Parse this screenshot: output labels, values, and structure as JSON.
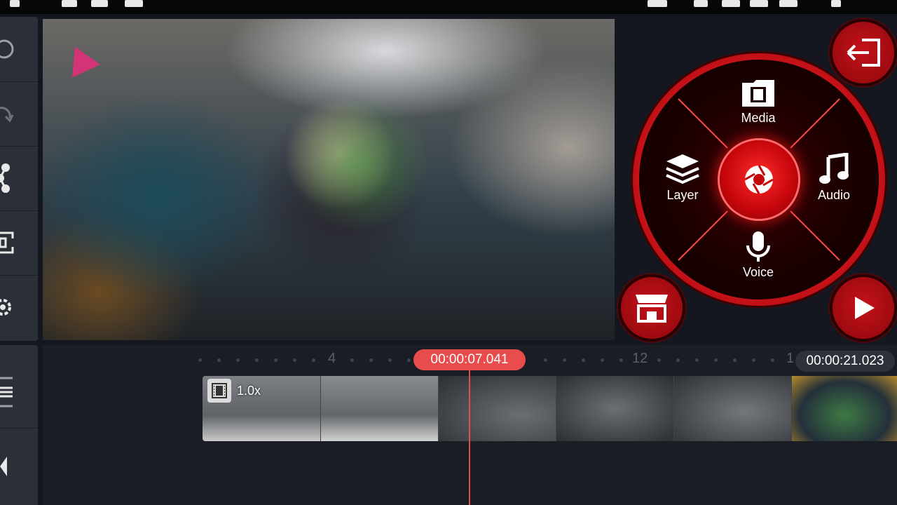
{
  "radial_menu": {
    "media_label": "Media",
    "audio_label": "Audio",
    "layer_label": "Layer",
    "voice_label": "Voice"
  },
  "timeline": {
    "current_time": "00:00:07.041",
    "total_duration": "00:00:21.023",
    "ruler_labels": [
      "4",
      "12",
      "1"
    ],
    "clip_speed": "1.0x"
  },
  "colors": {
    "accent_red": "#e94c4c",
    "menu_red": "#d4141b",
    "panel_bg": "#2b2f38",
    "timeline_bg": "#1a1d24"
  },
  "icons": {
    "sidebar": [
      "undo-icon",
      "redo-icon",
      "share-icon",
      "crop-icon",
      "settings-icon"
    ],
    "sidebar_bottom": [
      "timeline-expand-icon",
      "rewind-icon"
    ],
    "actions": [
      "exit-icon",
      "store-icon",
      "play-icon",
      "capture-icon"
    ]
  }
}
